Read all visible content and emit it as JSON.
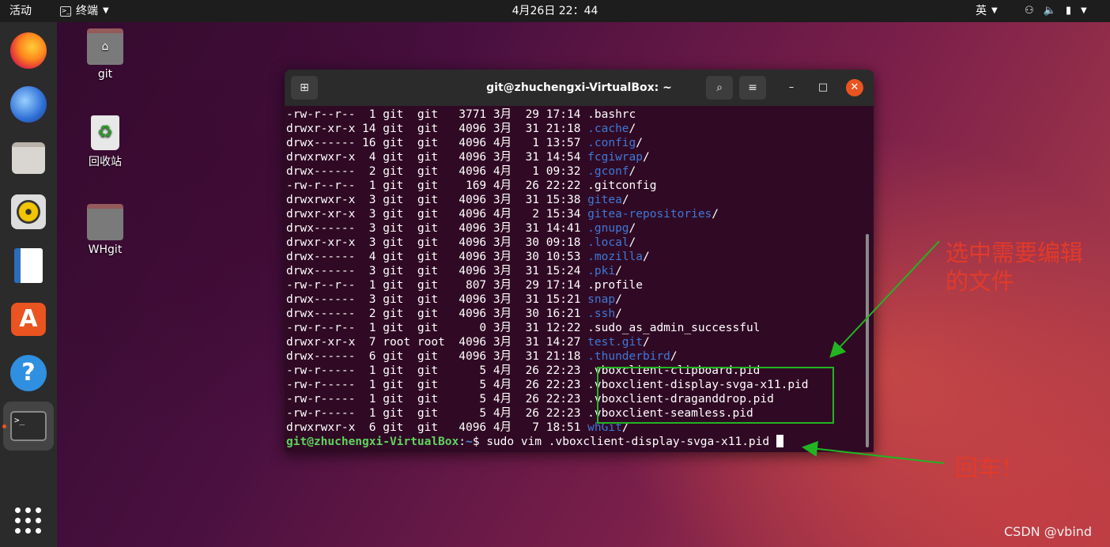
{
  "topbar": {
    "activities": "活动",
    "app_menu": "终端",
    "clock": "4月26日  22：44",
    "input_method": "英"
  },
  "dock": {
    "apps": [
      "firefox",
      "thunderbird",
      "files",
      "rhythmbox",
      "libreoffice-writer",
      "ubuntu-software",
      "help",
      "terminal"
    ],
    "active": "terminal"
  },
  "desktop": {
    "icons": [
      {
        "label": "git",
        "icon": "home-folder-icon"
      },
      {
        "label": "回收站",
        "icon": "trash-icon"
      },
      {
        "label": "WHgit",
        "icon": "folder-icon"
      }
    ]
  },
  "window": {
    "title": "git@zhuchengxi-VirtualBox: ~"
  },
  "terminal": {
    "rows": [
      {
        "meta": "-rw-r--r--  1 git  git   3771 3月  29 17:14 ",
        "name": ".bashrc",
        "dir": false,
        "suffix": ""
      },
      {
        "meta": "drwxr-xr-x 14 git  git   4096 3月  31 21:18 ",
        "name": ".cache",
        "dir": true,
        "suffix": "/"
      },
      {
        "meta": "drwx------ 16 git  git   4096 4月   1 13:57 ",
        "name": ".config",
        "dir": true,
        "suffix": "/"
      },
      {
        "meta": "drwxrwxr-x  4 git  git   4096 3月  31 14:54 ",
        "name": "fcgiwrap",
        "dir": true,
        "suffix": "/"
      },
      {
        "meta": "drwx------  2 git  git   4096 4月   1 09:32 ",
        "name": ".gconf",
        "dir": true,
        "suffix": "/"
      },
      {
        "meta": "-rw-r--r--  1 git  git    169 4月  26 22:22 ",
        "name": ".gitconfig",
        "dir": false,
        "suffix": ""
      },
      {
        "meta": "drwxrwxr-x  3 git  git   4096 3月  31 15:38 ",
        "name": "gitea",
        "dir": true,
        "suffix": "/"
      },
      {
        "meta": "drwxr-xr-x  3 git  git   4096 4月   2 15:34 ",
        "name": "gitea-repositories",
        "dir": true,
        "suffix": "/"
      },
      {
        "meta": "drwx------  3 git  git   4096 3月  31 14:41 ",
        "name": ".gnupg",
        "dir": true,
        "suffix": "/"
      },
      {
        "meta": "drwxr-xr-x  3 git  git   4096 3月  30 09:18 ",
        "name": ".local",
        "dir": true,
        "suffix": "/"
      },
      {
        "meta": "drwx------  4 git  git   4096 3月  30 10:53 ",
        "name": ".mozilla",
        "dir": true,
        "suffix": "/"
      },
      {
        "meta": "drwx------  3 git  git   4096 3月  31 15:24 ",
        "name": ".pki",
        "dir": true,
        "suffix": "/"
      },
      {
        "meta": "-rw-r--r--  1 git  git    807 3月  29 17:14 ",
        "name": ".profile",
        "dir": false,
        "suffix": ""
      },
      {
        "meta": "drwx------  3 git  git   4096 3月  31 15:21 ",
        "name": "snap",
        "dir": true,
        "suffix": "/"
      },
      {
        "meta": "drwx------  2 git  git   4096 3月  30 16:21 ",
        "name": ".ssh",
        "dir": true,
        "suffix": "/"
      },
      {
        "meta": "-rw-r--r--  1 git  git      0 3月  31 12:22 ",
        "name": ".sudo_as_admin_successful",
        "dir": false,
        "suffix": ""
      },
      {
        "meta": "drwxr-xr-x  7 root root  4096 3月  31 14:27 ",
        "name": "test.git",
        "dir": true,
        "suffix": "/"
      },
      {
        "meta": "drwx------  6 git  git   4096 3月  31 21:18 ",
        "name": ".thunderbird",
        "dir": true,
        "suffix": "/"
      },
      {
        "meta": "-rw-r-----  1 git  git      5 4月  26 22:23 ",
        "name": ".vboxclient-clipboard.pid",
        "dir": false,
        "suffix": ""
      },
      {
        "meta": "-rw-r-----  1 git  git      5 4月  26 22:23 ",
        "name": ".vboxclient-display-svga-x11.pid",
        "dir": false,
        "suffix": ""
      },
      {
        "meta": "-rw-r-----  1 git  git      5 4月  26 22:23 ",
        "name": ".vboxclient-draganddrop.pid",
        "dir": false,
        "suffix": ""
      },
      {
        "meta": "-rw-r-----  1 git  git      5 4月  26 22:23 ",
        "name": ".vboxclient-seamless.pid",
        "dir": false,
        "suffix": ""
      },
      {
        "meta": "drwxrwxr-x  6 git  git   4096 4月   7 18:51 ",
        "name": "whGit",
        "dir": true,
        "suffix": "/"
      }
    ],
    "prompt_user": "git@zhuchengxi-VirtualBox",
    "prompt_sep": ":",
    "prompt_path": "~",
    "prompt_sym": "$ ",
    "command": "sudo vim .vboxclient-display-svga-x11.pid "
  },
  "annotations": {
    "select_note": "选中需要编辑\n的文件",
    "enter_note": "回车！",
    "color": "#e23a2a",
    "box_color": "#22b522"
  },
  "watermark": "CSDN @vbind"
}
